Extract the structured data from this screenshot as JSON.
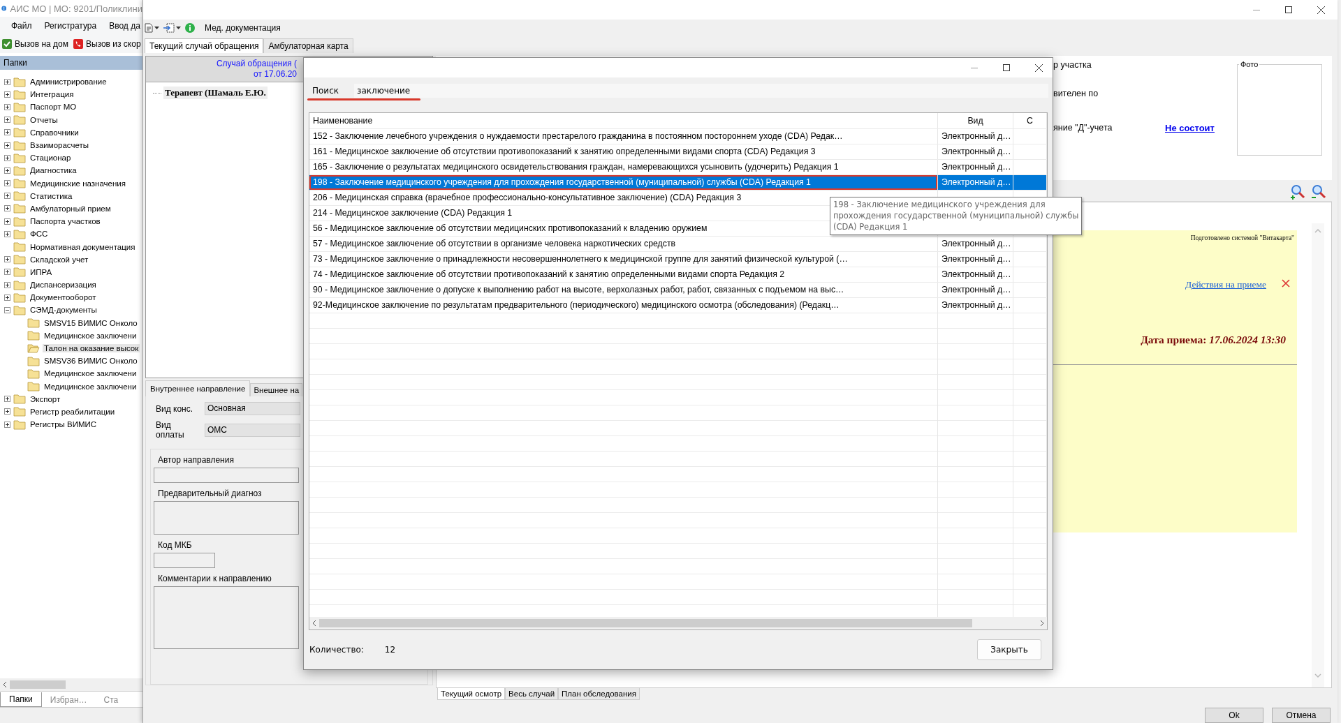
{
  "main_window": {
    "title": "АИС МО | МО: 9201/Поликлини",
    "menu": [
      "Файл",
      "Регистратура",
      "Ввод да"
    ],
    "toolbar": [
      {
        "label": "Вызов на дом",
        "kind": "home"
      },
      {
        "label": "Вызов из скор",
        "kind": "ambulance"
      }
    ],
    "folders": {
      "title": "Папки",
      "items": [
        {
          "label": "Администрирование",
          "expanded": false,
          "selected": false
        },
        {
          "label": "Интеграция",
          "expanded": false,
          "selected": false
        },
        {
          "label": "Паспорт МО",
          "expanded": false,
          "selected": false
        },
        {
          "label": "Отчеты",
          "expanded": false,
          "selected": false
        },
        {
          "label": "Справочники",
          "expanded": false,
          "selected": false
        },
        {
          "label": "Взаиморасчеты",
          "expanded": false,
          "selected": false
        },
        {
          "label": "Стационар",
          "expanded": false,
          "selected": false
        },
        {
          "label": "Диагностика",
          "expanded": false,
          "selected": false
        },
        {
          "label": "Медицинские назначения",
          "expanded": false,
          "selected": false
        },
        {
          "label": "Статистика",
          "expanded": false,
          "selected": false
        },
        {
          "label": "Амбулаторный прием",
          "expanded": false,
          "selected": false
        },
        {
          "label": "Паспорта участков",
          "expanded": false,
          "selected": false
        },
        {
          "label": "ФСС",
          "expanded": false,
          "selected": false
        },
        {
          "label": "Нормативная документация",
          "selected": false
        },
        {
          "label": "Складской учет",
          "expanded": false,
          "selected": false
        },
        {
          "label": "ИПРА",
          "expanded": false,
          "selected": false
        },
        {
          "label": "Диспансеризация",
          "expanded": false,
          "selected": false
        },
        {
          "label": "Документооборот",
          "expanded": false,
          "selected": false
        },
        {
          "label": "СЭМД-документы",
          "expanded": true,
          "selected": false,
          "children": [
            {
              "label": "SMSV15 ВИМИС Онколо",
              "selected": false
            },
            {
              "label": "Медицинское заключени",
              "selected": false
            },
            {
              "label": "Талон на оказание высок",
              "selected": true
            },
            {
              "label": "SMSV36 ВИМИС Онколо",
              "selected": false
            },
            {
              "label": "Медицинское заключени",
              "selected": false
            },
            {
              "label": "Медицинское заключени",
              "selected": false
            }
          ]
        },
        {
          "label": "Экспорт",
          "expanded": false,
          "selected": false
        },
        {
          "label": "Регистр реабилитации",
          "expanded": false,
          "selected": false
        },
        {
          "label": "Регистры ВИМИС",
          "expanded": false,
          "selected": false
        }
      ]
    },
    "bottom_tabs": [
      {
        "label": "Папки",
        "selected": true
      },
      {
        "label": "Избран…",
        "selected": false
      },
      {
        "label": "Ста",
        "selected": false
      }
    ]
  },
  "record_window": {
    "toolbar_label": "Мед. документация",
    "tabs": [
      {
        "label": "Текущий случай обращения",
        "selected": true
      },
      {
        "label": "Амбулаторная карта",
        "selected": false
      }
    ],
    "case": {
      "title_lines": [
        "Случай обращения (",
        "от 17.06.20"
      ],
      "tree": [
        {
          "label": "Терапевт (Шамаль Е.Ю.",
          "selected": true
        }
      ]
    },
    "referral": {
      "tabs": [
        {
          "label": "Внутреннее направление",
          "selected": true
        },
        {
          "label": "Внешнее на",
          "selected": false
        }
      ],
      "fields": [
        {
          "label": "Вид конс.",
          "value": "Основная"
        },
        {
          "label": "Вид оплаты",
          "value": "ОМС"
        }
      ],
      "group_fields": [
        {
          "label": "Автор направления",
          "kind": "line"
        },
        {
          "label": "Предварительный диагноз",
          "kind": "area"
        },
        {
          "label": "Код МКБ",
          "kind": "short"
        },
        {
          "label": "Комментарии к направлению",
          "kind": "large"
        }
      ]
    },
    "patient": {
      "rows": [
        {
          "label": "р участка"
        },
        {
          "label": "вителен по"
        },
        {
          "label": "яние \"Д\"-учета",
          "value": "Не состоит"
        }
      ],
      "photo_label": "Фото"
    },
    "document": {
      "prepared_by": "Подготовлено системой \"Витакарта\"",
      "actions_link": "Действия на приеме",
      "date": "Дата приема: *17.06.2024 13:30*"
    },
    "view_tabs": [
      {
        "label": "Текущий осмотр",
        "selected": true
      },
      {
        "label": "Весь случай",
        "selected": false
      },
      {
        "label": "План обследования",
        "selected": false
      }
    ],
    "buttons": [
      "Ok",
      "Отмена"
    ]
  },
  "dialog": {
    "search": {
      "label": "Поиск",
      "value": "заключение"
    },
    "table": {
      "columns": [
        "Наименование",
        "Вид",
        "С"
      ],
      "rows": [
        {
          "name": "152 - Заключение лечебного учреждения о нуждаемости престарелого гражданина в постоянном постороннем уходе (CDA) Редак…",
          "doc_type": "Электронный д…",
          "selected": false
        },
        {
          "name": "161 - Медицинское заключение об отсутствии противопоказаний к занятию определенными видами спорта (CDA) Редакция 3",
          "doc_type": "Электронный д…",
          "selected": false
        },
        {
          "name": "165 - Заключение о результатах медицинского освидетельствования граждан, намеревающихся усыновить (удочерить) Редакция 1",
          "doc_type": "Электронный д…",
          "selected": false
        },
        {
          "name": "198 - Заключение медицинского учреждения для прохождения государственной (муниципальной) службы (CDA) Редакция 1",
          "doc_type": "Электронный д…",
          "selected": true
        },
        {
          "name": "206 - Медицинская справка (врачебное профессионально-консультативное заключение) (CDA) Редакция 3",
          "selected": false
        },
        {
          "name": "214 - Медицинское заключение (CDA) Редакция 1",
          "selected": false
        },
        {
          "name": "56 - Медицинское заключение об отсутствии медицинских противопоказаний к владению оружием",
          "selected": false
        },
        {
          "name": "57 - Медицинское заключение об отсутствии в организме человека наркотических средств",
          "doc_type": "Электронный д…",
          "selected": false
        },
        {
          "name": "73 - Медицинское заключение о принадлежности несовершеннолетнего к медицинской группе для занятий физической культурой (…",
          "doc_type": "Электронный д…",
          "selected": false
        },
        {
          "name": "74 - Медицинское заключение об отсутствии противопоказаний к занятию определенными видами спорта Редакция 2",
          "doc_type": "Электронный д…",
          "selected": false
        },
        {
          "name": "90 - Медицинское заключение о допуске к выполнению работ на высоте, верхолазных работ, работ, связанных с подъемом на выс…",
          "doc_type": "Электронный д…",
          "selected": false
        },
        {
          "name": "92-Медицинское заключение по результатам предварительного (периодического) медицинского осмотра (обследования) (Редакц…",
          "doc_type": "Электронный д…",
          "selected": false
        }
      ]
    },
    "count_label": "Количество:",
    "count": "12",
    "close_button": "Закрыть"
  },
  "tooltip": {
    "lines": [
      "198 - Заключение медицинского учреждения для",
      "прохождения государственной (муниципальной) службы",
      "(CDA) Редакция 1"
    ]
  }
}
